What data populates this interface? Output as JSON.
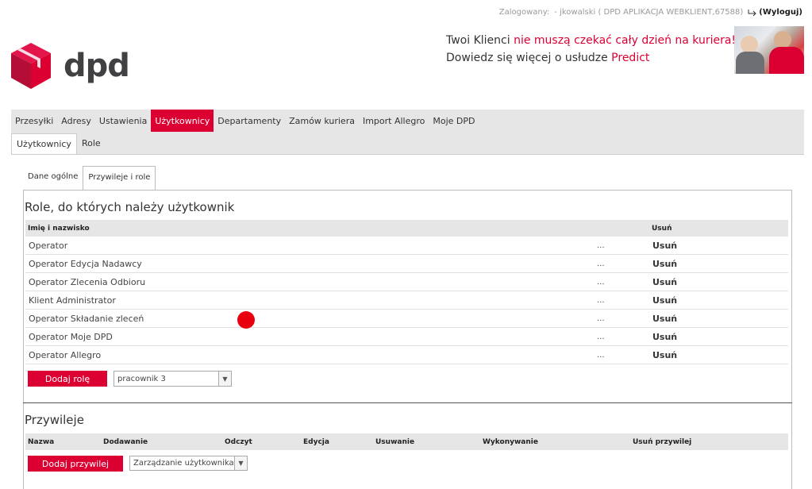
{
  "header": {
    "login_label": "Zalogowany:",
    "login_user": "- jkowalski ( DPD APLIKACJA WEBKLIENT,67588)",
    "logout_label": "(Wyloguj)",
    "logo_text": "dpd",
    "promo_line1_a": "Twoi Klienci ",
    "promo_line1_b": "nie muszą czekać cały dzień na kuriera!",
    "promo_line2_a": "Dowiedz się więcej o usłudze ",
    "promo_line2_b": "Predict"
  },
  "main_nav": [
    "Przesyłki",
    "Adresy",
    "Ustawienia",
    "Użytkownicy",
    "Departamenty",
    "Zamów kuriera",
    "Import Allegro",
    "Moje DPD"
  ],
  "main_nav_active": "Użytkownicy",
  "sub_nav": [
    "Użytkownicy",
    "Role"
  ],
  "tabs": [
    "Dane ogólne",
    "Przywileje i role"
  ],
  "roles_section": {
    "title": "Role, do których należy użytkownik",
    "col_name": "Imię i nazwisko",
    "col_more": "",
    "col_delete": "Usuń",
    "rows": [
      {
        "name": "Operator",
        "more": "...",
        "delete": "Usuń"
      },
      {
        "name": "Operator Edycja Nadawcy",
        "more": "...",
        "delete": "Usuń"
      },
      {
        "name": "Operator Zlecenia Odbioru",
        "more": "...",
        "delete": "Usuń"
      },
      {
        "name": "Klient Administrator",
        "more": "...",
        "delete": "Usuń"
      },
      {
        "name": "Operator Składanie zleceń",
        "more": "...",
        "delete": "Usuń"
      },
      {
        "name": "Operator Moje DPD",
        "more": "...",
        "delete": "Usuń"
      },
      {
        "name": "Operator Allegro",
        "more": "...",
        "delete": "Usuń"
      }
    ],
    "add_button": "Dodaj rolę",
    "select_value": "pracownik 3"
  },
  "privileges_section": {
    "title": "Przywileje",
    "columns": [
      "Nazwa",
      "Dodawanie",
      "Odczyt",
      "Edycja",
      "Usuwanie",
      "Wykonywanie",
      "Usuń przywilej"
    ],
    "add_button": "Dodaj przywilej",
    "select_value": "Zarządzanie użytkownikami"
  },
  "colors": {
    "accent": "#dc0032",
    "nav_bg": "#e6e6e6"
  }
}
